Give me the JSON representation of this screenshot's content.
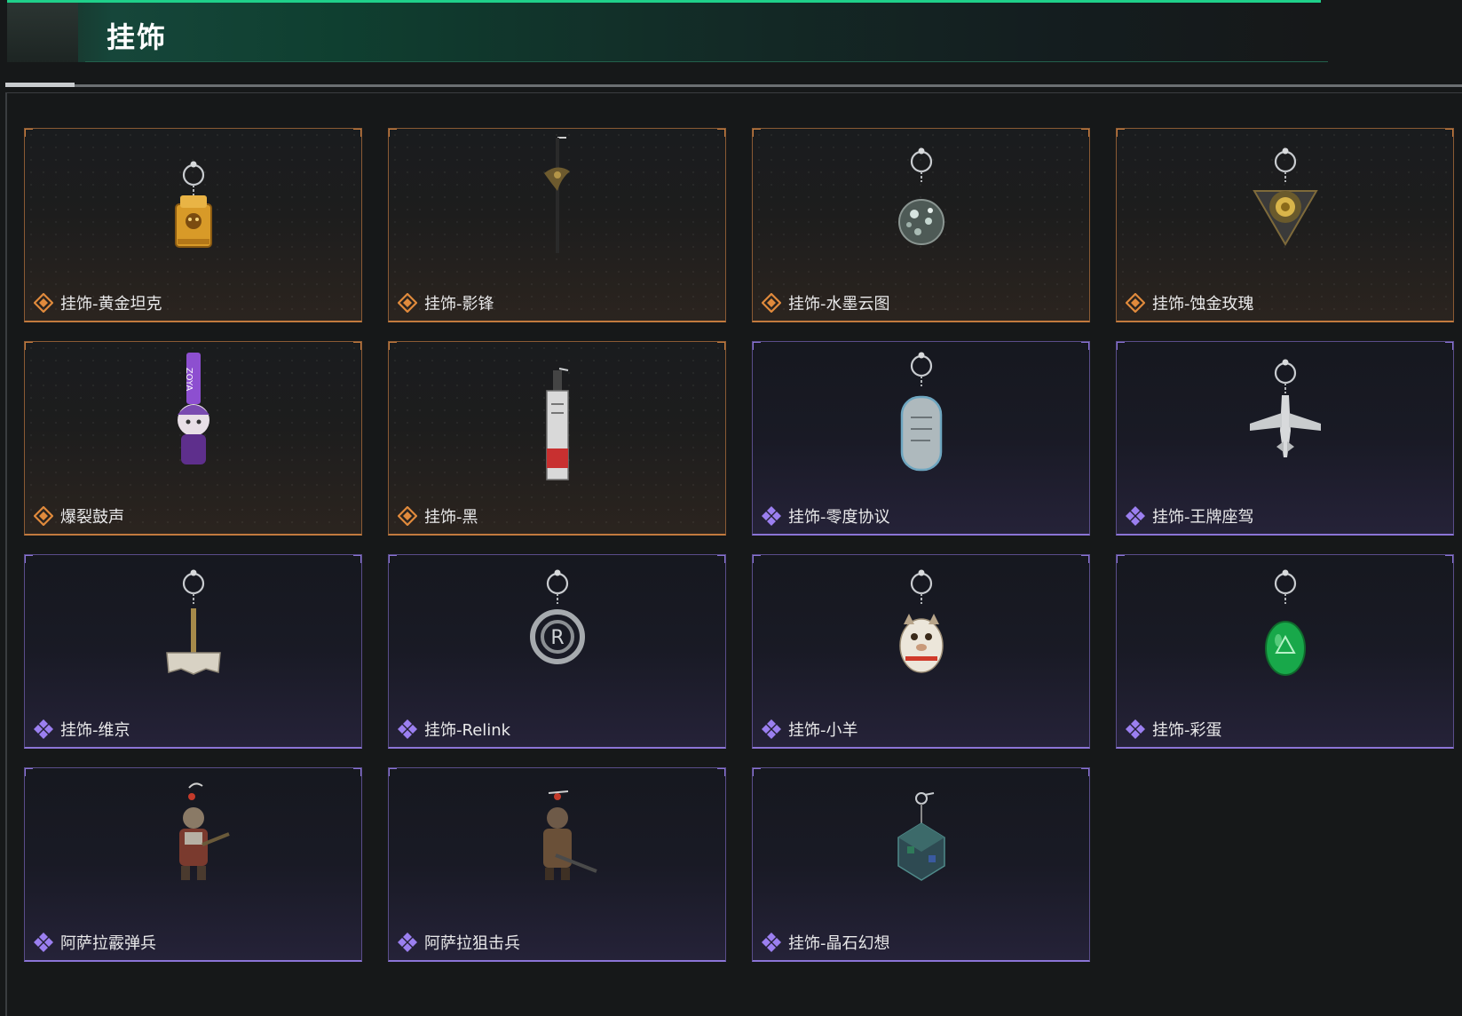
{
  "header": {
    "title": "挂饰"
  },
  "colors": {
    "accent_green": "#1fd08a",
    "rarity_gold": "#c27a3e",
    "rarity_purple": "#8b74d6"
  },
  "items": [
    {
      "name": "挂饰-黄金坦克",
      "rarity": "gold",
      "icon": "golden-tank-charm-icon"
    },
    {
      "name": "挂饰-影锋",
      "rarity": "gold",
      "icon": "shadow-blade-charm-icon"
    },
    {
      "name": "挂饰-水墨云图",
      "rarity": "gold",
      "icon": "ink-cloud-sphere-charm-icon"
    },
    {
      "name": "挂饰-蚀金玫瑰",
      "rarity": "gold",
      "icon": "gold-rose-charm-icon"
    },
    {
      "name": "爆裂鼓声",
      "rarity": "gold",
      "icon": "chibi-character-charm-icon"
    },
    {
      "name": "挂饰-黑",
      "rarity": "gold",
      "icon": "tag-charm-icon"
    },
    {
      "name": "挂饰-零度协议",
      "rarity": "purple",
      "icon": "dog-tag-charm-icon"
    },
    {
      "name": "挂饰-王牌座驾",
      "rarity": "purple",
      "icon": "jet-plane-charm-icon"
    },
    {
      "name": "挂饰-维京",
      "rarity": "purple",
      "icon": "viking-hammer-charm-icon"
    },
    {
      "name": "挂饰-Relink",
      "rarity": "purple",
      "icon": "relink-logo-charm-icon"
    },
    {
      "name": "挂饰-小羊",
      "rarity": "purple",
      "icon": "lucky-cat-charm-icon"
    },
    {
      "name": "挂饰-彩蛋",
      "rarity": "purple",
      "icon": "green-egg-charm-icon"
    },
    {
      "name": "阿萨拉霰弹兵",
      "rarity": "purple",
      "icon": "shotgunner-figure-charm-icon"
    },
    {
      "name": "阿萨拉狙击兵",
      "rarity": "purple",
      "icon": "sniper-figure-charm-icon"
    },
    {
      "name": "挂饰-晶石幻想",
      "rarity": "purple",
      "icon": "crystal-cube-charm-icon"
    }
  ]
}
